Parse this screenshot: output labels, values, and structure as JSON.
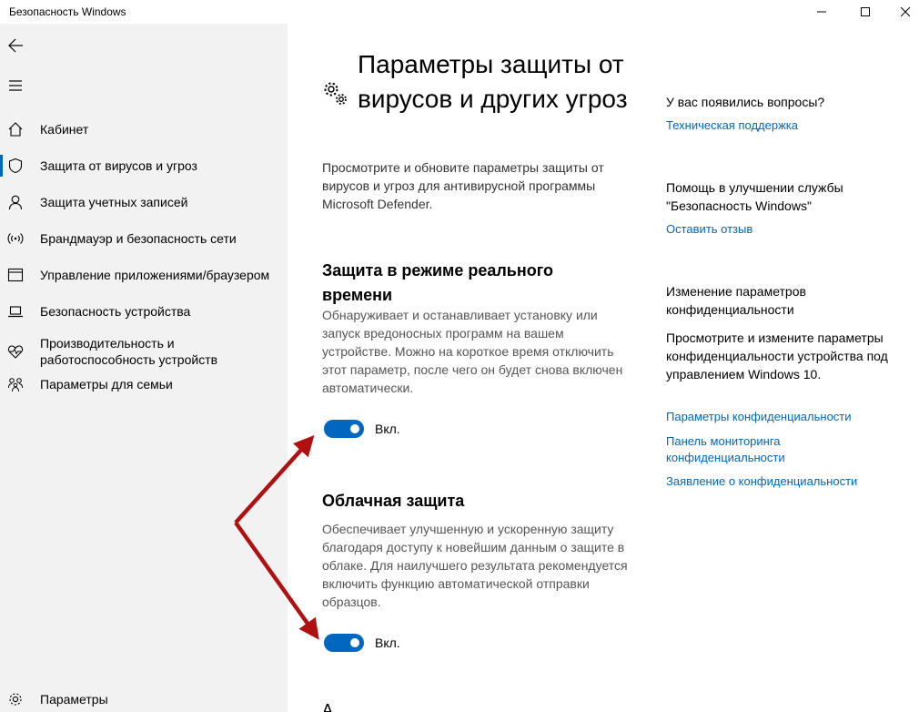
{
  "window": {
    "title": "Безопасность Windows"
  },
  "sidebar": {
    "items": [
      {
        "label": "Кабинет",
        "icon": "home-icon"
      },
      {
        "label": "Защита от вирусов и угроз",
        "icon": "shield-icon",
        "active": true
      },
      {
        "label": "Защита учетных записей",
        "icon": "person-icon"
      },
      {
        "label": "Брандмауэр и безопасность сети",
        "icon": "wifi-signal-icon"
      },
      {
        "label": "Управление приложениями/браузером",
        "icon": "browser-window-icon"
      },
      {
        "label": "Безопасность устройства",
        "icon": "laptop-icon"
      },
      {
        "label": "Производительность и работоспособность устройств",
        "icon": "heart-pulse-icon"
      },
      {
        "label": "Параметры для семьи",
        "icon": "family-icon"
      }
    ],
    "settings_label": "Параметры"
  },
  "main": {
    "title": "Параметры защиты от вирусов и других угроз",
    "description": "Просмотрите и обновите параметры защиты от вирусов и угроз для антивирусной программы Microsoft Defender.",
    "realtime": {
      "title": "Защита в режиме реального времени",
      "description": "Обнаруживает и останавливает установку или запуск вредоносных программ на вашем устройстве. Можно на короткое время отключить этот параметр, после чего он будет снова включен автоматически.",
      "toggle_label": "Вкл.",
      "enabled": true
    },
    "cloud": {
      "title": "Облачная защита",
      "description": "Обеспечивает улучшенную и ускоренную защиту благодаря доступу к новейшим данным о защите в облаке. Для наилучшего результата рекомендуется включить функцию автоматической отправки образцов.",
      "toggle_label": "Вкл.",
      "enabled": true
    },
    "next_section_partial": "А"
  },
  "help": {
    "questions_heading": "У вас появились вопросы?",
    "support_link": "Техническая поддержка",
    "improve_heading": "Помощь в улучшении службы \"Безопасность Windows\"",
    "feedback_link": "Оставить отзыв",
    "privacy_heading": "Изменение параметров конфиденциальности",
    "privacy_desc": "Просмотрите и измените параметры конфиденциальности устройства под управлением Windows 10.",
    "privacy_settings_link": "Параметры конфиденциальности",
    "privacy_dashboard_link": "Панель мониторинга конфиденциальности",
    "privacy_statement_link": "Заявление о конфиденциальности"
  },
  "colors": {
    "accent": "#0067c0",
    "sidebar_bg": "#f2f2f2",
    "arrow": "#b01010"
  }
}
